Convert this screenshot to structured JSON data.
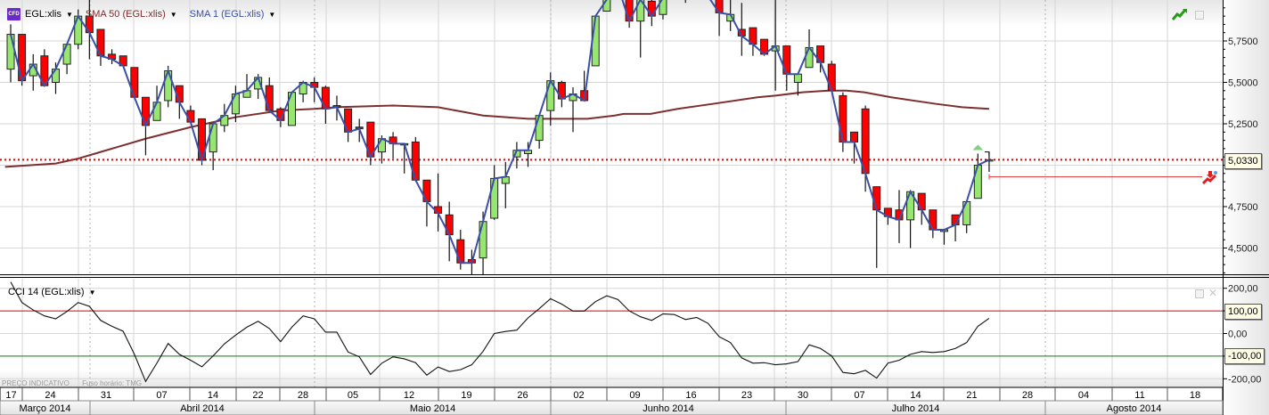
{
  "legend": {
    "symbol": "EGL:xlis",
    "symbol_badge": "CFD",
    "sma50": "SMA 50 (EGL:xlis)",
    "sma1": "SMA 1 (EGL:xlis)",
    "cci": "CCI 14 (EGL:xlis)"
  },
  "colors": {
    "up": "#98e672",
    "down": "#ff0000",
    "sma50": "#7e2e2e",
    "sma1": "#3b4fa8",
    "last_price_line": "#e00000",
    "cci_line": "#111111",
    "cci_upper": "#e00000",
    "cci_lower": "#0a7a0a",
    "grid": "#d6d6d6"
  },
  "footer": {
    "price_note": "PREÇO INDICATIVO",
    "timezone": "Fuso horário: TMG"
  },
  "chart_data": [
    {
      "type": "candlestick",
      "title": "EGL:xlis",
      "ylim": [
        4.33,
        6.0
      ],
      "y_ticks": [
        {
          "value": 5.75,
          "label": "5,7500"
        },
        {
          "value": 5.5,
          "label": "5,5000"
        },
        {
          "value": 5.25,
          "label": "5,2500"
        },
        {
          "value": 4.75,
          "label": "4,7500"
        },
        {
          "value": 4.5,
          "label": "4,5000"
        }
      ],
      "gridlines": [
        6.0,
        5.75,
        5.5,
        5.25,
        5.0,
        4.75,
        4.5
      ],
      "last_price": {
        "value": 5.033,
        "label": "5,0330"
      },
      "ohlc": [
        [
          5.58,
          5.85,
          5.5,
          5.79
        ],
        [
          5.79,
          5.79,
          5.48,
          5.51
        ],
        [
          5.54,
          5.67,
          5.45,
          5.61
        ],
        [
          5.66,
          5.7,
          5.48,
          5.48
        ],
        [
          5.5,
          5.62,
          5.43,
          5.58
        ],
        [
          5.61,
          5.73,
          5.55,
          5.73
        ],
        [
          5.73,
          5.94,
          5.7,
          5.9
        ],
        [
          5.9,
          6.0,
          5.64,
          5.8
        ],
        [
          5.82,
          5.82,
          5.6,
          5.66
        ],
        [
          5.67,
          5.7,
          5.61,
          5.64
        ],
        [
          5.66,
          5.66,
          5.6,
          5.6
        ],
        [
          5.59,
          5.59,
          5.41,
          5.41
        ],
        [
          5.41,
          5.41,
          5.06,
          5.24
        ],
        [
          5.27,
          5.48,
          5.27,
          5.38
        ],
        [
          5.39,
          5.6,
          5.35,
          5.57
        ],
        [
          5.48,
          5.48,
          5.28,
          5.38
        ],
        [
          5.33,
          5.36,
          5.26,
          5.26
        ],
        [
          5.28,
          5.28,
          5.0,
          5.03
        ],
        [
          5.08,
          5.25,
          4.97,
          5.25
        ],
        [
          5.24,
          5.37,
          5.2,
          5.3
        ],
        [
          5.31,
          5.48,
          5.26,
          5.43
        ],
        [
          5.41,
          5.55,
          5.41,
          5.45
        ],
        [
          5.46,
          5.55,
          5.4,
          5.53
        ],
        [
          5.48,
          5.53,
          5.33,
          5.33
        ],
        [
          5.34,
          5.35,
          5.23,
          5.27
        ],
        [
          5.24,
          5.44,
          5.24,
          5.44
        ],
        [
          5.43,
          5.51,
          5.38,
          5.5
        ],
        [
          5.5,
          5.53,
          5.38,
          5.47
        ],
        [
          5.47,
          5.48,
          5.25,
          5.34
        ],
        [
          5.36,
          5.42,
          5.27,
          5.35
        ],
        [
          5.34,
          5.34,
          5.14,
          5.2
        ],
        [
          5.23,
          5.28,
          5.14,
          5.22
        ],
        [
          5.26,
          5.26,
          5.0,
          5.05
        ],
        [
          5.08,
          5.18,
          5.01,
          5.16
        ],
        [
          5.17,
          5.2,
          5.04,
          5.13
        ],
        [
          5.13,
          5.13,
          4.95,
          5.13
        ],
        [
          5.14,
          5.17,
          4.91,
          4.91
        ],
        [
          4.91,
          4.91,
          4.63,
          4.78
        ],
        [
          4.75,
          4.95,
          4.6,
          4.71
        ],
        [
          4.7,
          4.78,
          4.42,
          4.58
        ],
        [
          4.55,
          4.61,
          4.37,
          4.41
        ],
        [
          4.43,
          4.49,
          4.34,
          4.41
        ],
        [
          4.44,
          4.72,
          4.34,
          4.66
        ],
        [
          4.68,
          5.0,
          4.67,
          4.92
        ],
        [
          4.89,
          5.02,
          4.74,
          4.93
        ],
        [
          5.05,
          5.14,
          4.98,
          5.09
        ],
        [
          5.07,
          5.14,
          4.99,
          5.09
        ],
        [
          5.15,
          5.3,
          5.1,
          5.3
        ],
        [
          5.33,
          5.56,
          5.24,
          5.51
        ],
        [
          5.5,
          5.51,
          5.35,
          5.4
        ],
        [
          5.39,
          5.47,
          5.2,
          5.43
        ],
        [
          5.45,
          5.57,
          5.39,
          5.39
        ],
        [
          5.6,
          5.9,
          5.6,
          5.9
        ],
        [
          5.93,
          6.05,
          5.93,
          6.0
        ],
        [
          6.05,
          6.12,
          6.02,
          6.08
        ],
        [
          6.02,
          6.06,
          5.83,
          5.87
        ],
        [
          5.87,
          6.05,
          5.65,
          6.0
        ],
        [
          5.99,
          6.03,
          5.84,
          5.9
        ],
        [
          5.91,
          6.05,
          5.88,
          6.01
        ],
        [
          6.05,
          6.1,
          6.01,
          6.08
        ],
        [
          6.06,
          6.1,
          5.98,
          6.04
        ],
        [
          6.06,
          6.1,
          6.02,
          6.05
        ],
        [
          6.05,
          6.08,
          6.01,
          6.02
        ],
        [
          6.02,
          6.03,
          5.78,
          5.92
        ],
        [
          5.87,
          6.0,
          5.81,
          5.91
        ],
        [
          5.82,
          5.98,
          5.66,
          5.78
        ],
        [
          5.83,
          5.83,
          5.66,
          5.73
        ],
        [
          5.76,
          5.76,
          5.66,
          5.67
        ],
        [
          5.69,
          6.0,
          5.45,
          5.72
        ],
        [
          5.72,
          5.72,
          5.45,
          5.55
        ],
        [
          5.5,
          5.55,
          5.42,
          5.55
        ],
        [
          5.59,
          5.82,
          5.59,
          5.71
        ],
        [
          5.72,
          5.72,
          5.56,
          5.62
        ],
        [
          5.61,
          5.63,
          5.45,
          5.45
        ],
        [
          5.42,
          5.44,
          5.08,
          5.14
        ],
        [
          5.2,
          5.2,
          5.01,
          5.14
        ],
        [
          5.34,
          5.36,
          4.84,
          4.95
        ],
        [
          4.87,
          4.87,
          4.38,
          4.73
        ],
        [
          4.74,
          4.74,
          4.64,
          4.69
        ],
        [
          4.73,
          4.85,
          4.53,
          4.67
        ],
        [
          4.67,
          4.85,
          4.5,
          4.84
        ],
        [
          4.83,
          4.83,
          4.64,
          4.73
        ],
        [
          4.73,
          4.73,
          4.56,
          4.61
        ],
        [
          4.6,
          4.61,
          4.52,
          4.61
        ],
        [
          4.7,
          4.7,
          4.54,
          4.64
        ],
        [
          4.64,
          4.78,
          4.59,
          4.78
        ],
        [
          4.8,
          5.07,
          4.8,
          5.0
        ],
        [
          5.03,
          5.08,
          4.96,
          5.033
        ]
      ],
      "sma1": "close",
      "sma50_points": [
        [
          -0.5,
          4.99
        ],
        [
          4,
          5.01
        ],
        [
          6,
          5.04
        ],
        [
          8,
          5.08
        ],
        [
          12,
          5.16
        ],
        [
          16,
          5.23
        ],
        [
          20,
          5.29
        ],
        [
          24,
          5.33
        ],
        [
          27,
          5.34
        ],
        [
          29,
          5.35
        ],
        [
          34,
          5.36
        ],
        [
          38,
          5.35
        ],
        [
          42,
          5.3
        ],
        [
          46,
          5.28
        ],
        [
          48,
          5.28
        ],
        [
          51.3,
          5.28
        ],
        [
          53.7,
          5.3
        ],
        [
          54.5,
          5.31
        ],
        [
          56.9,
          5.31
        ],
        [
          59.3,
          5.34
        ],
        [
          62.4,
          5.37
        ],
        [
          66.4,
          5.41
        ],
        [
          68,
          5.42
        ],
        [
          70.4,
          5.44
        ],
        [
          72.7,
          5.45
        ],
        [
          74.3,
          5.45
        ],
        [
          75.9,
          5.44
        ],
        [
          78.3,
          5.41
        ],
        [
          82.3,
          5.37
        ],
        [
          84.6,
          5.35
        ],
        [
          87,
          5.34
        ]
      ],
      "alert_level": 4.93
    },
    {
      "type": "line",
      "title": "CCI 14 (EGL:xlis)",
      "ylim": [
        -220,
        220
      ],
      "y_ticks": [
        {
          "value": 200,
          "label": "200,00"
        },
        {
          "value": 0,
          "label": "0,00"
        },
        {
          "value": -200,
          "label": "-200,00"
        }
      ],
      "levels": [
        {
          "value": 100,
          "label": "100,00"
        },
        {
          "value": -100,
          "label": "-100,00"
        }
      ],
      "values": [
        228,
        137,
        104,
        78,
        65,
        97,
        137,
        120,
        58,
        32,
        10,
        -92,
        -212,
        -131,
        -44,
        -92,
        -118,
        -147,
        -99,
        -46,
        -7,
        28,
        54,
        22,
        -36,
        28,
        78,
        65,
        6,
        6,
        -82,
        -103,
        -181,
        -131,
        -103,
        -112,
        -129,
        -184,
        -148,
        -168,
        -160,
        -138,
        -79,
        0,
        9,
        15,
        69,
        110,
        154,
        130,
        99,
        99,
        141,
        167,
        150,
        100,
        74,
        58,
        87,
        84,
        62,
        71,
        45,
        -14,
        -40,
        -108,
        -131,
        -129,
        -138,
        -134,
        -124,
        -50,
        -66,
        -99,
        -172,
        -178,
        -163,
        -197,
        -131,
        -118,
        -92,
        -80,
        -84,
        -80,
        -66,
        -40,
        32,
        67
      ]
    }
  ],
  "x_axis": {
    "weeks": [
      "17",
      "24",
      "31",
      "07",
      "14",
      "22",
      "28",
      "05",
      "12",
      "19",
      "26",
      "02",
      "09",
      "16",
      "23",
      "30",
      "07",
      "14",
      "21",
      "28",
      "04",
      "11",
      "18"
    ],
    "months": [
      "Março 2014",
      "Abril 2014",
      "Maio 2014",
      "Junho 2014",
      "Julho 2014",
      "Agosto 2014"
    ]
  }
}
